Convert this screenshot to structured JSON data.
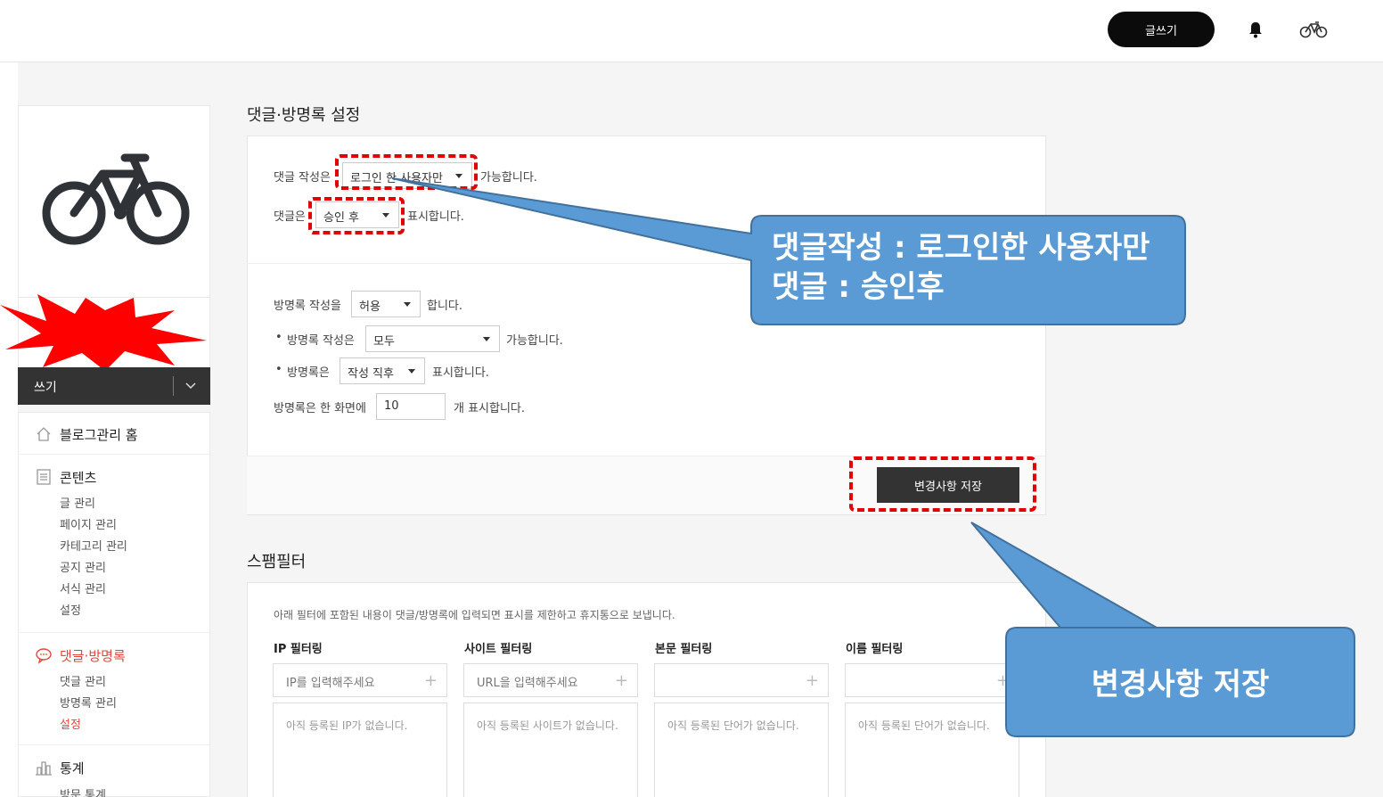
{
  "topbar": {
    "write_label": "글쓰기",
    "bell_icon": "bell-icon",
    "avatar_icon": "bicycle-icon"
  },
  "sidebar": {
    "write_label": "쓰기",
    "sections": [
      {
        "label": "블로그관리 홈",
        "icon": "home-icon"
      },
      {
        "label": "콘텐츠",
        "icon": "document-icon",
        "items": [
          "글 관리",
          "페이지 관리",
          "카테고리 관리",
          "공지 관리",
          "서식 관리",
          "설정"
        ]
      },
      {
        "label": "댓글·방명록",
        "icon": "comment-icon",
        "items": [
          "댓글 관리",
          "방명록 관리",
          "설정"
        ]
      },
      {
        "label": "통계",
        "icon": "stats-icon",
        "items": [
          "방문 통계"
        ]
      }
    ]
  },
  "comment_settings": {
    "title": "댓글·방명록 설정",
    "comment_write_prefix": "댓글 작성은",
    "comment_write_value": "로그인 한 사용자만",
    "comment_write_suffix": "가능합니다.",
    "comment_show_prefix": "댓글은",
    "comment_show_value": "승인 후",
    "comment_show_suffix": "표시합니다.",
    "guestbook_write_prefix": "방명록 작성을",
    "guestbook_write_value": "허용",
    "guestbook_write_suffix": "합니다.",
    "guestbook_who_prefix": "방명록 작성은",
    "guestbook_who_value": "모두",
    "guestbook_who_suffix": "가능합니다.",
    "guestbook_show_prefix": "방명록은",
    "guestbook_show_value": "작성 직후",
    "guestbook_show_suffix": "표시합니다.",
    "guestbook_count_prefix": "방명록은 한 화면에",
    "guestbook_count_value": "10",
    "guestbook_count_suffix": "개 표시합니다.",
    "bullet": "•",
    "save_label": "변경사항 저장"
  },
  "spam_filter": {
    "title": "스팸필터",
    "description": "아래 필터에 포함된 내용이 댓글/방명록에 입력되면 표시를 제한하고 휴지통으로 보냅니다.",
    "columns": [
      {
        "label": "IP 필터링",
        "placeholder": "IP를 입력해주세요",
        "empty": "아직 등록된 IP가 없습니다."
      },
      {
        "label": "사이트 필터링",
        "placeholder": "URL을 입력해주세요",
        "empty": "아직 등록된 사이트가 없습니다."
      },
      {
        "label": "본문 필터링",
        "placeholder": "",
        "empty": "아직 등록된 단어가 없습니다."
      },
      {
        "label": "이름 필터링",
        "placeholder": "",
        "empty": "아직 등록된 단어가 없습니다."
      }
    ]
  },
  "annotations": {
    "callout1_line1": "댓글작성 : 로그인한 사용자만",
    "callout1_line2": "댓글 : 승인후",
    "callout2": "변경사항 저장",
    "callout_color": "#5b9bd5",
    "highlight_color": "#e30000"
  }
}
